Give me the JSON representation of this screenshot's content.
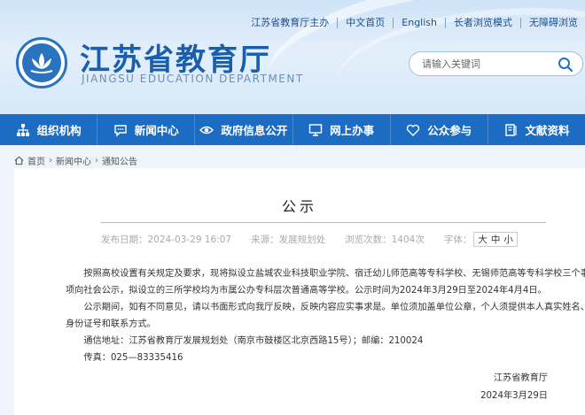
{
  "toplinks": [
    "江苏省教育厅主办",
    "中文首页",
    "English",
    "长者浏览模式",
    "无障碍浏览"
  ],
  "site": {
    "title": "江苏省教育厅",
    "subtitle": "JIANGSU EDUCATION DEPARTMENT"
  },
  "search": {
    "placeholder": "请输入关键词",
    "icon": "search-icon"
  },
  "nav": [
    {
      "label": "组织机构",
      "icon": "org-icon"
    },
    {
      "label": "新闻中心",
      "icon": "chat-icon"
    },
    {
      "label": "政府信息公开",
      "icon": "eye-icon"
    },
    {
      "label": "网上办事",
      "icon": "monitor-icon"
    },
    {
      "label": "公众参与",
      "icon": "heart-icon"
    },
    {
      "label": "文献资料",
      "icon": "book-icon"
    }
  ],
  "breadcrumb": [
    "首页",
    "新闻中心",
    "通知公告"
  ],
  "article": {
    "title": "公示",
    "meta": {
      "date": "发布日期：2024-03-29 16:07",
      "source": "来源：发展规划处",
      "views_label": "浏览次数：",
      "views": "1404次",
      "font_label": "字体：",
      "font_sizes": [
        "大",
        "中",
        "小"
      ]
    },
    "paragraphs": [
      "按照高校设置有关规定及要求，现将拟设立盐城农业科技职业学院、宿迁幼儿师范高等专科学校、无锡师范高等专科学校三个事",
      "项向社会公示，拟设立的三所学校均为市属公办专科层次普通高等学校。公示时间为2024年3月29日至2024年4月4日。",
      "公示期间，如有不同意见，请以书面形式向我厅反映，反映内容应实事求是。单位须加盖单位公章，个人须提供本人真实姓名、",
      "身份证号和联系方式。",
      "通信地址：江苏省教育厅发展规划处（南京市鼓楼区北京西路15号）；邮编：210024",
      "传真：025—83335416"
    ],
    "signature": {
      "org": "江苏省教育厅",
      "date": "2024年3月29日"
    }
  }
}
